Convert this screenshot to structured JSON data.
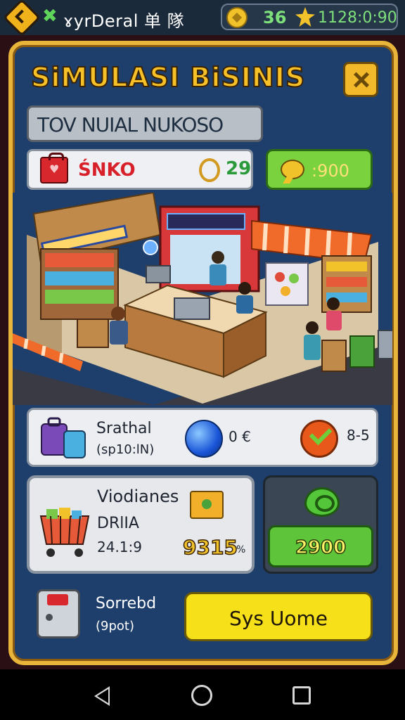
{
  "topbar": {
    "app_title": "ɤyrDeral 单 隊",
    "coins": "36",
    "time": "1128:0:90"
  },
  "screen": {
    "title": "SiMULASI BiSINIS",
    "banner": "TOV NUIAL NUKOSO"
  },
  "shop": {
    "name": "ŚNKO",
    "level": "29",
    "chat_value": ":900"
  },
  "stats": {
    "title": "Srathal",
    "subtitle": "(sp10:lN)",
    "value1": "0 €",
    "value2": "8-5"
  },
  "cart": {
    "title": "Viodianes",
    "subtitle": "DRlIA",
    "code": "24.1:9",
    "price": "9315",
    "pct": "%"
  },
  "upgrade": {
    "value": "2900"
  },
  "bonus": {
    "title": "Sorrebd",
    "subtitle": "(9pot)",
    "button_label": "Sys Uome"
  },
  "colors": {
    "frame_gold": "#e9b43a",
    "panel_blue": "#1e3e6c",
    "accent_green": "#5ec43a",
    "accent_yellow": "#f6e01a"
  }
}
